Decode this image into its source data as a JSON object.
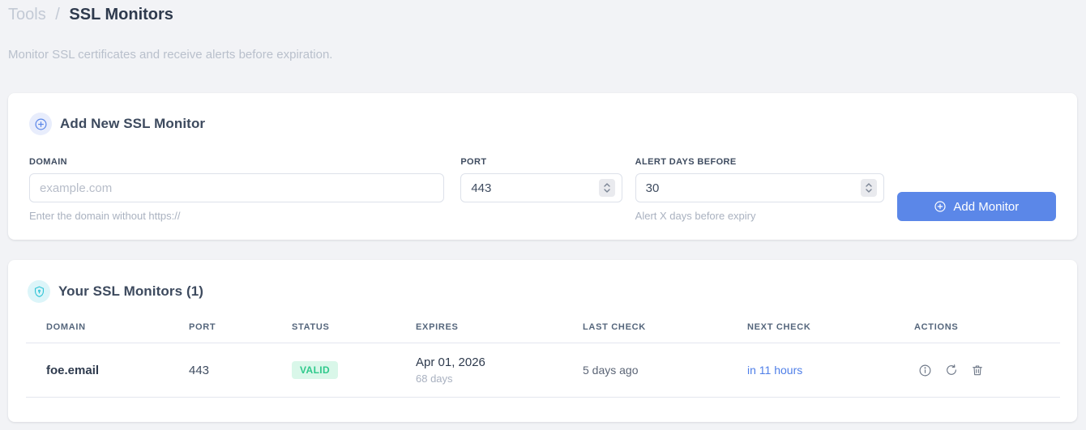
{
  "breadcrumb": {
    "section": "Tools",
    "separator": "/",
    "page": "SSL Monitors"
  },
  "subtitle": "Monitor SSL certificates and receive alerts before expiration.",
  "add_form": {
    "title": "Add New SSL Monitor",
    "icon": "circle-plus-icon",
    "fields": {
      "domain": {
        "label": "DOMAIN",
        "value": "",
        "placeholder": "example.com",
        "hint": "Enter the domain without https://"
      },
      "port": {
        "label": "PORT",
        "value": "443"
      },
      "alert_days": {
        "label": "ALERT DAYS BEFORE",
        "value": "30",
        "hint": "Alert X days before expiry"
      }
    },
    "submit_label": "Add Monitor"
  },
  "monitors": {
    "title": "Your SSL Monitors (1)",
    "count": "1",
    "icon": "shield-icon",
    "columns": [
      "DOMAIN",
      "PORT",
      "STATUS",
      "EXPIRES",
      "LAST CHECK",
      "NEXT CHECK",
      "ACTIONS"
    ],
    "rows": [
      {
        "domain": "foe.email",
        "port": "443",
        "status": "VALID",
        "expires_date": "Apr 01, 2026",
        "expires_in": "68 days",
        "last_check": "5 days ago",
        "next_check": "in 11 hours",
        "actions": [
          "info-icon",
          "refresh-icon",
          "trash-icon"
        ]
      }
    ]
  },
  "colors": {
    "accent_blue": "#5b87e8",
    "teal": "#2fc4d6",
    "badge_green_bg": "#d9f7e9",
    "badge_green_text": "#2fc98c",
    "next_check_blue": "#4f7fe8",
    "page_bg": "#f2f3f6"
  }
}
